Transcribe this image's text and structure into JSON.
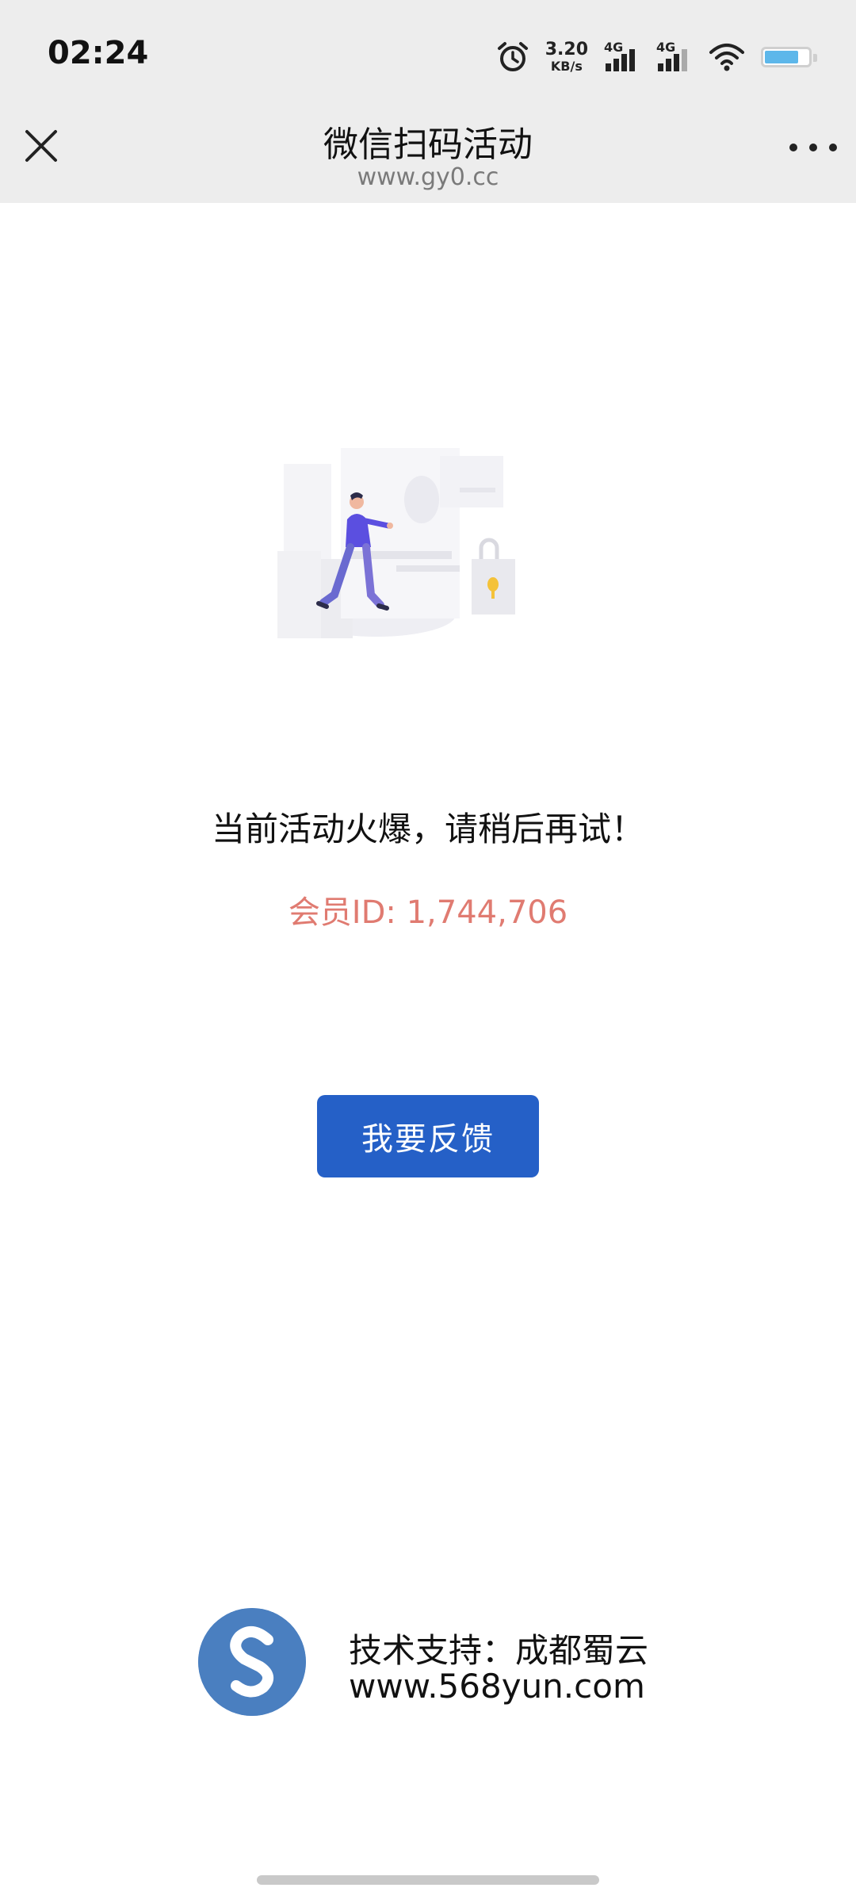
{
  "status_bar": {
    "time": "02:24",
    "net_speed_value": "3.20",
    "net_speed_unit": "KB/s",
    "signal_1_label": "4G",
    "signal_2_label": "4G",
    "icons": [
      "alarm-icon",
      "signal-icon",
      "signal-icon",
      "wifi-icon",
      "battery-icon"
    ],
    "battery_color": "#5db7ea"
  },
  "nav": {
    "title": "微信扫码活动",
    "subtitle": "www.gy0.cc",
    "close_icon": "close-icon",
    "more_icon": "more-icon"
  },
  "main": {
    "illustration": "person-walking-lock-illustration",
    "message": "当前活动火爆，请稍后再试！",
    "member_id": "会员ID: 1,744,706",
    "member_id_color": "#e07b71",
    "feedback_button": "我要反馈",
    "button_color": "#2560c7"
  },
  "footer": {
    "logo_icon": "s-logo-icon",
    "support_text": "技术支持：成都蜀云",
    "url": "www.568yun.com",
    "logo_color": "#4a7fc0"
  }
}
